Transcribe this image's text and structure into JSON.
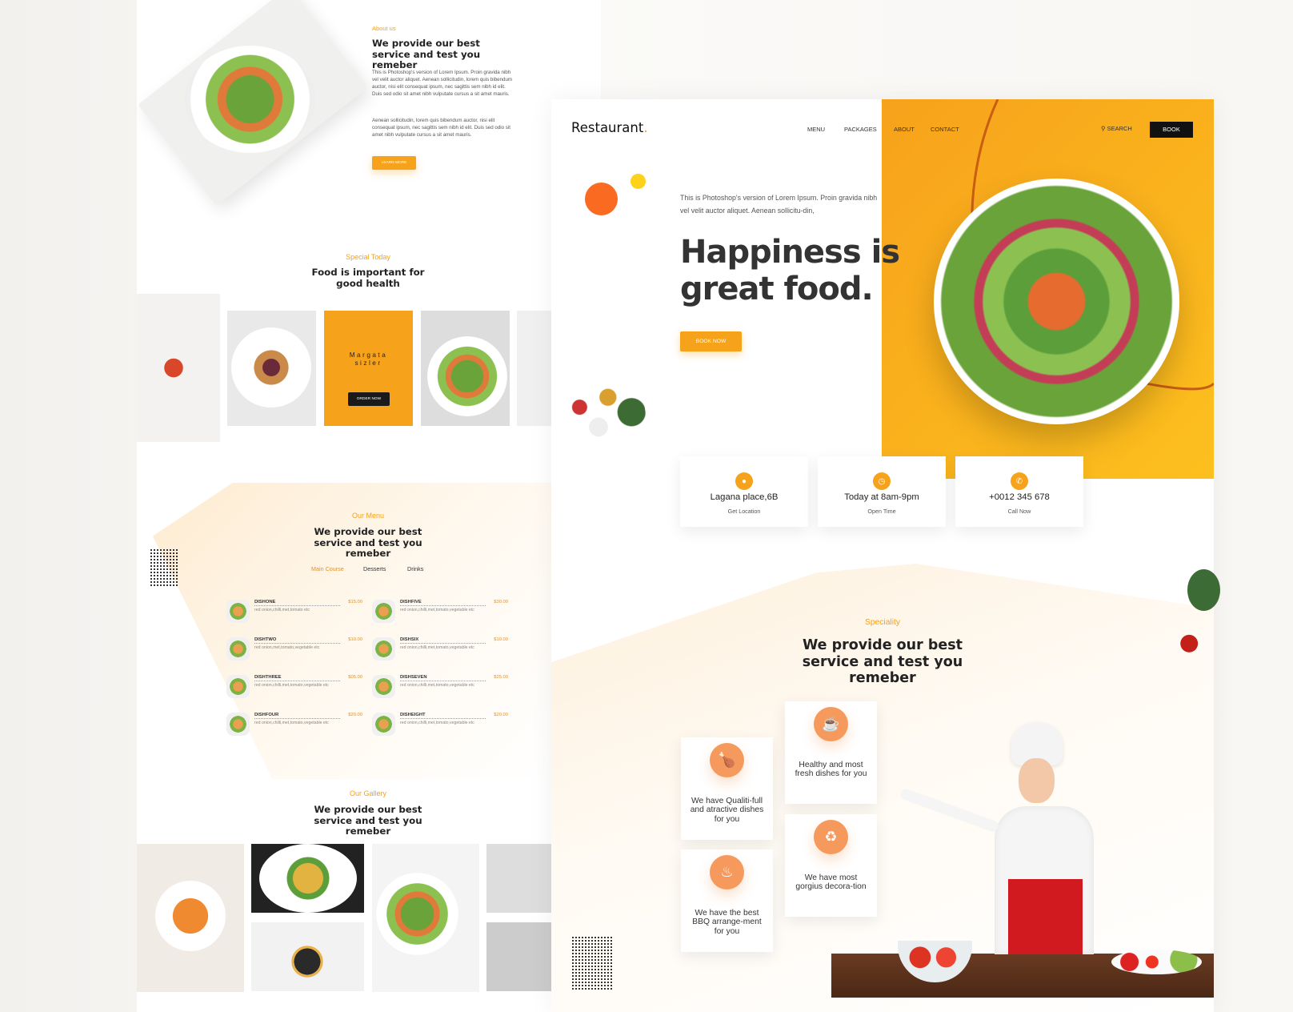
{
  "about": {
    "eyebrow": "About us",
    "title": "We provide our best service and test you remeber",
    "para1": "This is Photoshop's version  of Lorem Ipsum. Proin gravida nibh vel velit auctor aliquet. Aenean sollicitudin, lorem quis bibendum auctor, nisi elit consequat ipsum, nec sagittis sem nibh id elit. Duis sed odio sit amet nibh vulputate cursus a sit amet mauris.",
    "para2": "Aenean sollicitudin, lorem quis bibendum auctor, nisi elit consequat ipsum, nec sagittis sem nibh id elit. Duis sed odio sit amet nibh vulputate cursus a sit amet mauris.",
    "button": "LEARN MORE"
  },
  "special": {
    "eyebrow": "Special Today",
    "title": "Food is important for good health",
    "promo_name": "Margata sizler",
    "promo_button": "ORDER NOW"
  },
  "menu": {
    "eyebrow": "Our Menu",
    "title": "We provide our best service and test you remeber",
    "tabs": [
      "Main Course",
      "Desserts",
      "Drinks"
    ],
    "active_tab": "Main Course",
    "items": [
      {
        "name": "DISHONE",
        "price": "$15.00",
        "desc": "red onion,chilli,met,tomato etc"
      },
      {
        "name": "DISHTWO",
        "price": "$10.00",
        "desc": "red onion,met,tomato,vegetable etc"
      },
      {
        "name": "DISHTHREE",
        "price": "$05.00",
        "desc": "red onion,chilli,met,tomato,vegetable etc"
      },
      {
        "name": "DISHFOUR",
        "price": "$20.00",
        "desc": "red onion,chilli,met,tomato,vegetable etc"
      },
      {
        "name": "DISHFIVE",
        "price": "$30.00",
        "desc": "red onion,chilli,met,tomato,vegetable etc"
      },
      {
        "name": "DISHSIX",
        "price": "$10.00",
        "desc": "red onion,chilli,met,tomato,vegetable etc"
      },
      {
        "name": "DISHSEVEN",
        "price": "$25.00",
        "desc": "red onion,chilli,met,tomato,vegetable etc"
      },
      {
        "name": "DISHEIGHT",
        "price": "$20.00",
        "desc": "red onion,chilli,met,tomato,vegetable etc"
      }
    ]
  },
  "gallery": {
    "eyebrow": "Our Gallery",
    "title": "We provide our best service and test you remeber"
  },
  "header": {
    "logo": "Restaurant",
    "logo_dot": ".",
    "nav": [
      "MENU",
      "PACKAGES",
      "ABOUT",
      "CONTACT"
    ],
    "search": "SEARCH",
    "book": "BOOK"
  },
  "hero": {
    "intro": "This is Photoshop's version  of Lorem Ipsum. Proin gravida nibh vel velit auctor aliquet. Aenean sollicitu-din,",
    "title_line1": "Happiness is",
    "title_line2": "great food.",
    "button": "BOOK NOW"
  },
  "info": [
    {
      "icon": "location-pin-icon",
      "title": "Lagana place,6B",
      "sub": "Get Location"
    },
    {
      "icon": "clock-icon",
      "title": "Today at 8am-9pm",
      "sub": "Open Time"
    },
    {
      "icon": "phone-icon",
      "title": "+0012 345 678",
      "sub": "Call Now"
    }
  ],
  "speciality": {
    "eyebrow": "Speciality",
    "title": "We provide our best service and test you remeber",
    "cards": [
      {
        "icon": "roast-chicken-icon",
        "text": "We have Qualiti-full and atractive dishes for you"
      },
      {
        "icon": "fresh-bowl-icon",
        "text": "Healthy and most fresh dishes for you"
      },
      {
        "icon": "bbq-grill-icon",
        "text": "We have the best BBQ arrange-ment for you"
      },
      {
        "icon": "dining-table-icon",
        "text": "We have most gorgius decora-tion"
      }
    ]
  },
  "colors": {
    "accent": "#f7a21b",
    "speciality_icon": "#f59a5c",
    "dark": "#222222"
  }
}
